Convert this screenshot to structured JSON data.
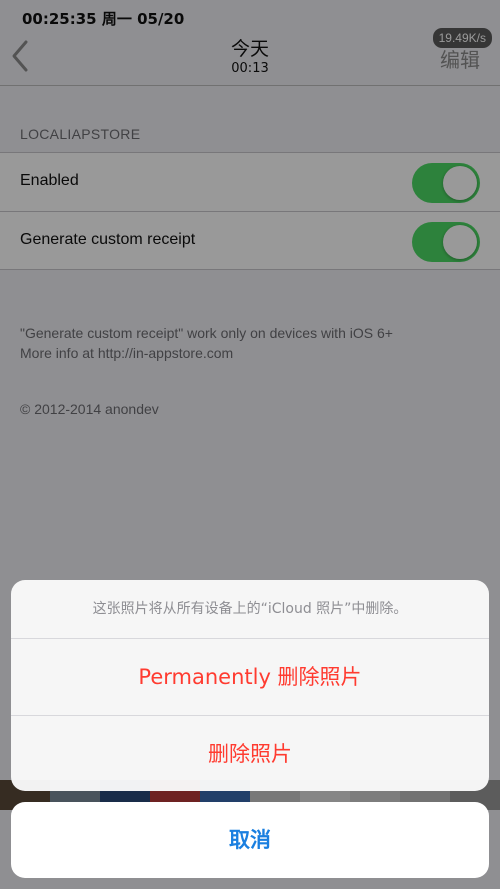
{
  "status_bar": {
    "text": "00:25:35 周一 05/20",
    "network_speed": "19.49K/s"
  },
  "nav": {
    "title": "今天",
    "subtitle": "00:13",
    "edit_label": "编辑",
    "back_icon": "chevron-left-icon"
  },
  "settings": {
    "section_header": "LOCALIAPSTORE",
    "rows": [
      {
        "label": "Enabled",
        "on": true
      },
      {
        "label": "Generate custom receipt",
        "on": true
      }
    ],
    "footer_line1": "\"Generate custom receipt\" work only on devices with iOS 6+",
    "footer_line2": "More info at http://in-appstore.com",
    "copyright": "© 2012-2014 anondev",
    "toggle_color": "#4cd964"
  },
  "action_sheet": {
    "message": "这张照片将从所有设备上的“iCloud 照片”中删除。",
    "actions": [
      {
        "label": "Permanently 删除照片"
      },
      {
        "label": "删除照片"
      }
    ],
    "cancel_label": "取消",
    "destructive_color": "#ff3b30",
    "cancel_color": "#1a7fe0"
  }
}
